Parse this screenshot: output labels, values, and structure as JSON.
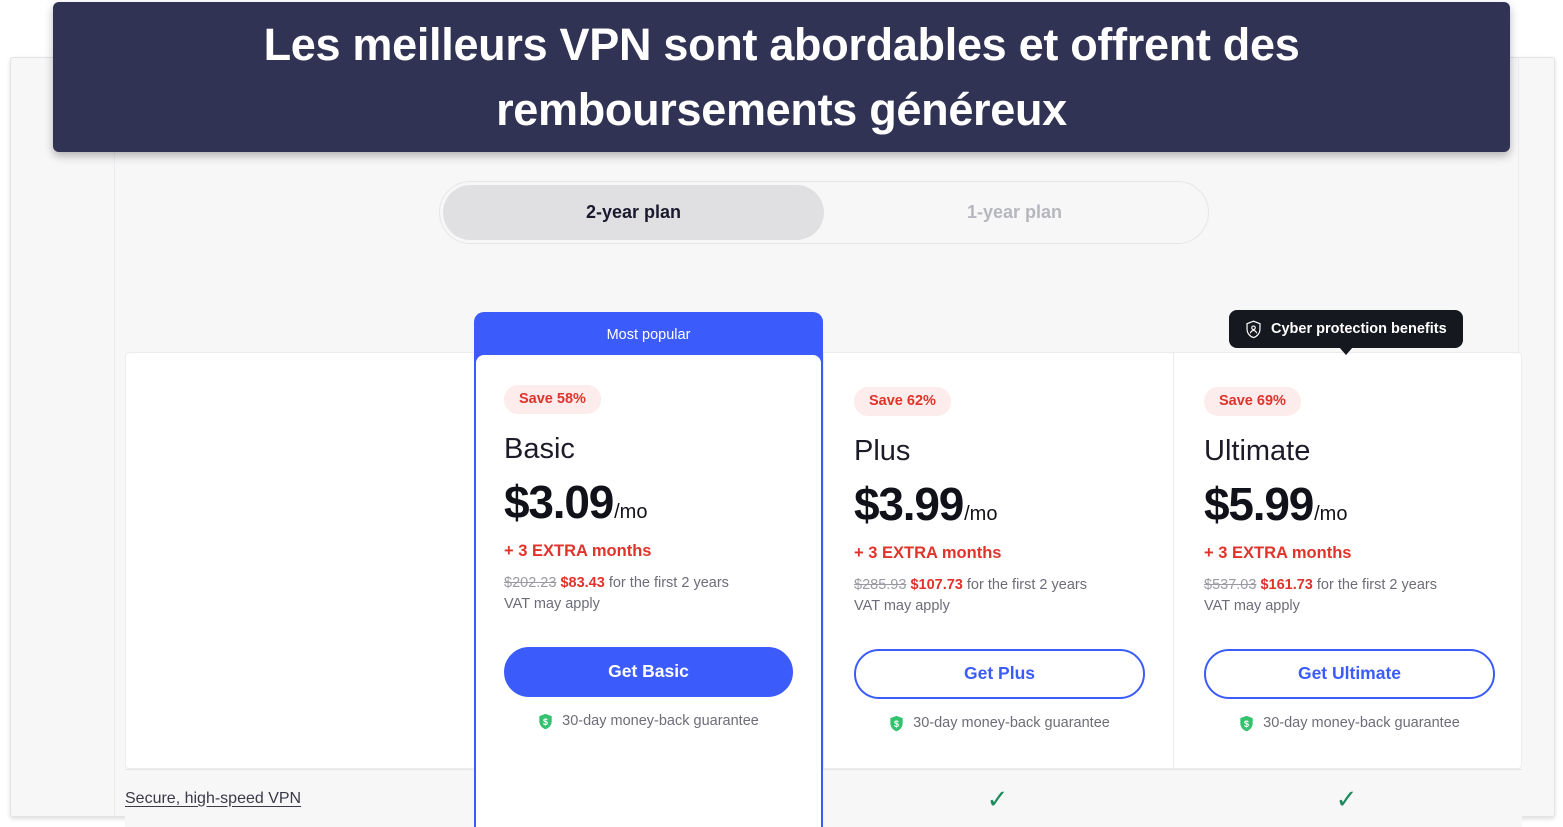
{
  "banner": {
    "headline": "Les meilleurs VPN sont abordables et offrent des remboursements généreux",
    "background_color": "#313354"
  },
  "plan_toggle": {
    "options": [
      {
        "label": "2-year plan",
        "state": "active"
      },
      {
        "label": "1-year plan",
        "state": "inactive"
      }
    ]
  },
  "tooltip": {
    "label": "Cyber protection benefits",
    "icon": "shield-user-icon",
    "background_color": "#16181f"
  },
  "featured": {
    "ribbon_label": "Most popular",
    "accent_color": "#3b5cfa"
  },
  "plans": [
    {
      "id": "basic",
      "save_badge": "Save 58%",
      "name": "Basic",
      "price": "$3.09",
      "period": "/mo",
      "extra_months": "+ 3 EXTRA months",
      "old_price": "$202.23",
      "new_price": "$83.43",
      "term_text": "for the first 2 years",
      "vat_note": "VAT may apply",
      "cta_label": "Get Basic",
      "cta_style": "filled",
      "guarantee": "30-day money-back guarantee",
      "guarantee_icon": "shield-dollar-icon",
      "feature_check": "✓"
    },
    {
      "id": "plus",
      "save_badge": "Save 62%",
      "name": "Plus",
      "price": "$3.99",
      "period": "/mo",
      "extra_months": "+ 3 EXTRA months",
      "old_price": "$285.93",
      "new_price": "$107.73",
      "term_text": "for the first 2 years",
      "vat_note": "VAT may apply",
      "cta_label": "Get Plus",
      "cta_style": "outline",
      "guarantee": "30-day money-back guarantee",
      "guarantee_icon": "shield-dollar-icon",
      "feature_check": "✓"
    },
    {
      "id": "ultimate",
      "save_badge": "Save 69%",
      "name": "Ultimate",
      "price": "$5.99",
      "period": "/mo",
      "extra_months": "+ 3 EXTRA months",
      "old_price": "$537.03",
      "new_price": "$161.73",
      "term_text": "for the first 2 years",
      "vat_note": "VAT may apply",
      "cta_label": "Get Ultimate",
      "cta_style": "outline",
      "guarantee": "30-day money-back guarantee",
      "guarantee_icon": "shield-dollar-icon",
      "feature_check": "✓"
    }
  ],
  "comparison": {
    "feature_label": "Secure, high-speed VPN",
    "check_color": "#1e8a5f"
  },
  "colors": {
    "accent_blue": "#3b5cfa",
    "sale_red": "#e0332b",
    "badge_pink": "#fdecec",
    "navy": "#313354",
    "green": "#1e8a5f",
    "panel_gray": "#f7f7f8"
  }
}
